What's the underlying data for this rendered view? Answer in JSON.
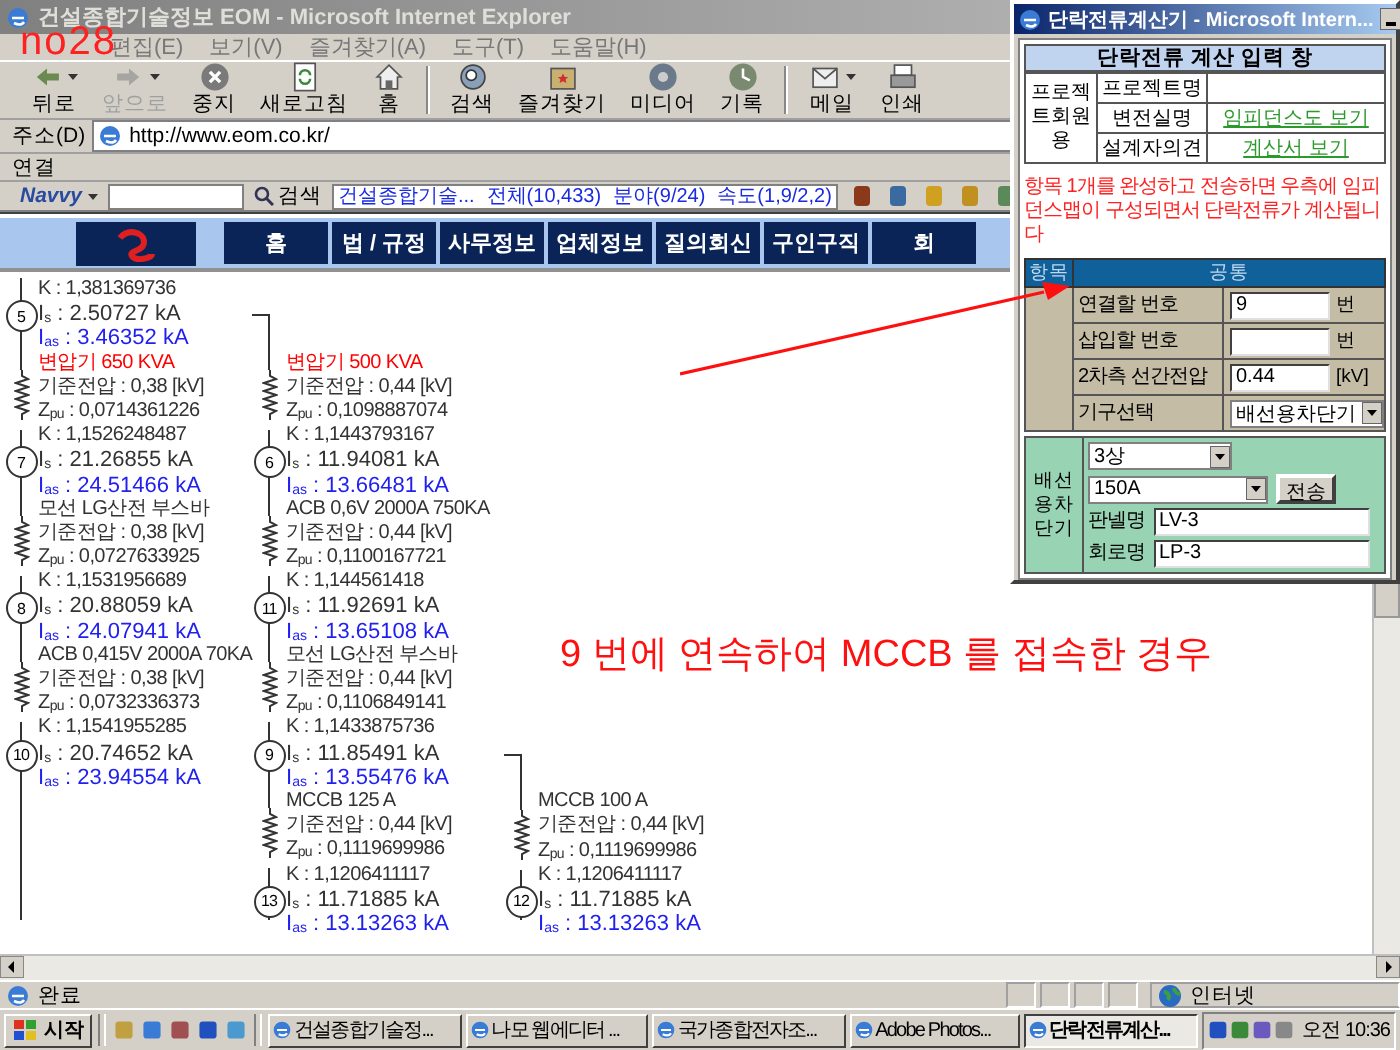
{
  "browser": {
    "title": "건설종합기술정보 EOM - Microsoft Internet Explorer",
    "annotation_label": "no28",
    "menu": [
      "편집(E)",
      "보기(V)",
      "즐겨찾기(A)",
      "도구(T)",
      "도움말(H)"
    ],
    "toolbar": [
      {
        "label": "뒤로",
        "disabled": false,
        "dropdown": true
      },
      {
        "label": "앞으로",
        "disabled": true,
        "dropdown": true
      },
      {
        "label": "중지",
        "disabled": false,
        "dropdown": false
      },
      {
        "label": "새로고침",
        "disabled": false,
        "dropdown": false
      },
      {
        "label": "홈",
        "disabled": false,
        "dropdown": false
      },
      {
        "label": "검색",
        "disabled": false,
        "dropdown": false
      },
      {
        "label": "즐겨찾기",
        "disabled": false,
        "dropdown": false
      },
      {
        "label": "미디어",
        "disabled": false,
        "dropdown": false
      },
      {
        "label": "기록",
        "disabled": false,
        "dropdown": false
      },
      {
        "label": "메일",
        "disabled": false,
        "dropdown": true
      },
      {
        "label": "인쇄",
        "disabled": false,
        "dropdown": false
      }
    ],
    "address": {
      "label": "주소(D)",
      "value": "http://www.eom.co.kr/"
    },
    "links_bar": {
      "label": "연결"
    },
    "navvy": {
      "brand": "Navvy",
      "search_button": "검색",
      "site": "건설종합기술...",
      "stats": [
        "전체(10,433)",
        "분야(9/24)",
        "속도(1,9/2,2)"
      ]
    }
  },
  "nav": [
    {
      "label": "홈"
    },
    {
      "label": "법 / 규정"
    },
    {
      "label": "사무정보"
    },
    {
      "label": "업체정보"
    },
    {
      "label": "질의회신"
    },
    {
      "label": "구인구직"
    },
    {
      "label": "회"
    }
  ],
  "diagram": {
    "columns": [
      {
        "branch": false,
        "items": [
          {
            "kind": "line",
            "text": "K : 1,381369736"
          },
          {
            "kind": "node",
            "number": "5",
            "is": "I$_{s}$ : 2.50727 kA",
            "ias": "I$_{as}$ : 3.46352 kA"
          },
          {
            "kind": "segment",
            "name": "변압기 650 KVA",
            "color": "#ff0000",
            "voltage": "기준전압 : 0,38 [kV]",
            "zpu": "Z$_{pu}$ : 0,0714361226",
            "k": "K : 1,1526248487"
          },
          {
            "kind": "node",
            "number": "7",
            "is": "I$_{s}$ : 21.26855 kA",
            "ias": "I$_{as}$ : 24.51466 kA"
          },
          {
            "kind": "segment",
            "name": "모선 LG산전 부스바",
            "color": "#333333",
            "voltage": "기준전압 : 0,38 [kV]",
            "zpu": "Z$_{pu}$ : 0,0727633925",
            "k": "K : 1,1531956689"
          },
          {
            "kind": "node",
            "number": "8",
            "is": "I$_{s}$ : 20.88059 kA",
            "ias": "I$_{as}$ : 24.07941 kA"
          },
          {
            "kind": "segment",
            "name": "ACB 0,415V 2000A 70KA",
            "color": "#333333",
            "voltage": "기준전압 : 0,38 [kV]",
            "zpu": "Z$_{pu}$ : 0,0732336373",
            "k": "K : 1,1541955285"
          },
          {
            "kind": "node",
            "number": "10",
            "is": "I$_{s}$ : 20.74652 kA",
            "ias": "I$_{as}$ : 23.94554 kA"
          }
        ]
      },
      {
        "branch": true,
        "items": [
          {
            "kind": "segment",
            "name": "변압기 500 KVA",
            "color": "#ff0000",
            "voltage": "기준전압 : 0,44 [kV]",
            "zpu": "Z$_{pu}$ : 0,1098887074",
            "k": "K : 1,1443793167"
          },
          {
            "kind": "node",
            "number": "6",
            "is": "I$_{s}$ : 11.94081 kA",
            "ias": "I$_{as}$ : 13.66481 kA"
          },
          {
            "kind": "segment",
            "name": "ACB 0,6V 2000A 750KA",
            "color": "#333333",
            "voltage": "기준전압 : 0,44 [kV]",
            "zpu": "Z$_{pu}$ : 0,1100167721",
            "k": "K : 1,144561418"
          },
          {
            "kind": "node",
            "number": "11",
            "is": "I$_{s}$ : 11.92691 kA",
            "ias": "I$_{as}$ : 13.65108 kA"
          },
          {
            "kind": "segment",
            "name": "모선 LG산전 부스바",
            "color": "#333333",
            "voltage": "기준전압 : 0,44 [kV]",
            "zpu": "Z$_{pu}$ : 0,1106849141",
            "k": "K : 1,1433875736"
          },
          {
            "kind": "node",
            "number": "9",
            "is": "I$_{s}$ : 11.85491 kA",
            "ias": "I$_{as}$ : 13.55476 kA"
          },
          {
            "kind": "segment",
            "name": "MCCB 125 A",
            "color": "#333333",
            "voltage": "기준전압 : 0,44 [kV]",
            "zpu": "Z$_{pu}$ : 0,1119699986",
            "k": "K : 1,1206411117"
          },
          {
            "kind": "node",
            "number": "13",
            "is": "I$_{s}$ : 11.71885 kA",
            "ias": "I$_{as}$ : 13.13263 kA"
          }
        ]
      },
      {
        "branch": true,
        "items": [
          {
            "kind": "segment",
            "name": "MCCB 100 A",
            "color": "#333333",
            "voltage": "기준전압 : 0,44 [kV]",
            "zpu": "Z$_{pu}$ : 0,1119699986",
            "k": "K : 1,1206411117"
          },
          {
            "kind": "node",
            "number": "12",
            "is": "I$_{s}$ : 11.71885 kA",
            "ias": "I$_{as}$ : 13.13263 kA"
          }
        ]
      }
    ]
  },
  "annotation": "9 번에 연속하여 MCCB 를 접속한 경우",
  "status_bar": {
    "text": "완료",
    "zone": "인터넷"
  },
  "popup": {
    "title": "단락전류계산기 - Microsoft Intern...",
    "heading": "단락전류 계산 입력 창",
    "project": {
      "group": "프로젝트회원용",
      "rows": [
        {
          "label": "프로젝트명"
        },
        {
          "label": "변전실명",
          "link": "임피던스도 보기"
        },
        {
          "label": "설계자의견",
          "link": "계산서 보기"
        }
      ]
    },
    "notice": "항목 1개를 완성하고 전송하면 우측에 임피던스맵이 구성되면서 단락전류가 계산됩니다",
    "form": {
      "columns": [
        "항목",
        "공통"
      ],
      "rows": [
        {
          "kind": "input",
          "label": "연결할 번호",
          "value": "9",
          "unit": "번"
        },
        {
          "kind": "input",
          "label": "삽입할 번호",
          "unit": "번"
        },
        {
          "kind": "input",
          "label": "2차측 선간전압",
          "value": "0.44",
          "unit": "[kV]"
        },
        {
          "kind": "select",
          "label": "기구선택",
          "value": "배선용차단기"
        }
      ]
    },
    "breaker": {
      "label": "배선용차단기",
      "phase": "3상",
      "rating": "150A",
      "button": "전송",
      "fields": [
        {
          "label": "판넬명",
          "value": "LV-3"
        },
        {
          "label": "회로명",
          "value": "LP-3"
        }
      ]
    }
  },
  "taskbar": {
    "start": "시작",
    "tasks": [
      {
        "label": "건설종합기술정...",
        "selected": false
      },
      {
        "label": "나모 웹에디터 ...",
        "selected": false
      },
      {
        "label": "국가종합전자조...",
        "selected": false
      },
      {
        "label": "Adobe Photos...",
        "selected": false
      },
      {
        "label": "단락전류계산...",
        "selected": true
      }
    ],
    "clock": "오전 10:36"
  }
}
